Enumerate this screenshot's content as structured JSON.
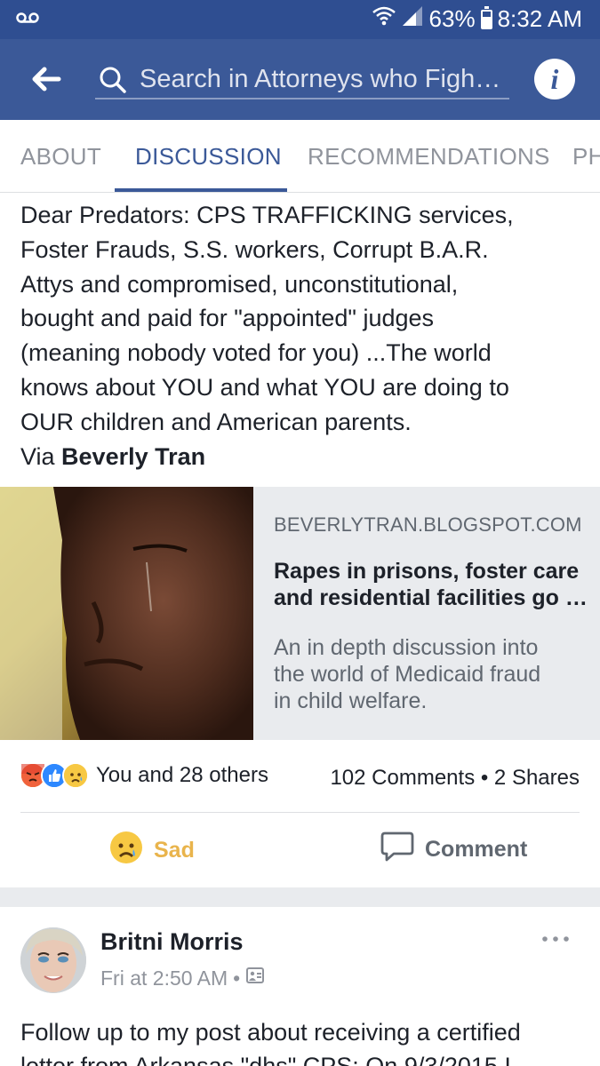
{
  "status_bar": {
    "battery": "63%",
    "time": "8:32 AM"
  },
  "app_bar": {
    "search_placeholder": "Search in Attorneys who Figh…"
  },
  "tabs": [
    {
      "label": "ABOUT"
    },
    {
      "label": "DISCUSSION"
    },
    {
      "label": "RECOMMENDATIONS"
    },
    {
      "label": "PH"
    }
  ],
  "post1": {
    "body_lines": [
      "Dear  Predators:  CPS TRAFFICKING services,",
      "Foster Frauds, S.S. workers, Corrupt B.A.R.",
      "Attys  and compromised, unconstitutional,",
      "bought and paid for \"appointed\" judges",
      "(meaning nobody voted for you) ...The world",
      "knows about YOU and what YOU are doing to",
      "OUR children and American parents."
    ],
    "via_prefix": "Via ",
    "via_name": "Beverly Tran",
    "link": {
      "domain": "BEVERLYTRAN.BLOGSPOT.COM",
      "title_lines": [
        "Rapes in prisons, foster care",
        "and residential facilities go …"
      ],
      "desc_lines": [
        "An in depth discussion into",
        "the world of Medicaid fraud",
        "in child welfare."
      ]
    },
    "reactions_text": "You and 28 others",
    "counts_text": "102 Comments • 2 Shares",
    "actions": {
      "sad": "Sad",
      "comment": "Comment"
    }
  },
  "post2": {
    "author": "Britni Morris",
    "time": "Fri at 2:50 AM",
    "separator": "•",
    "text_lines": [
      "Follow up to my post about receiving a certified",
      "letter from Arkansas \"dhs\" CPS: On 9/3/2015 I"
    ]
  }
}
